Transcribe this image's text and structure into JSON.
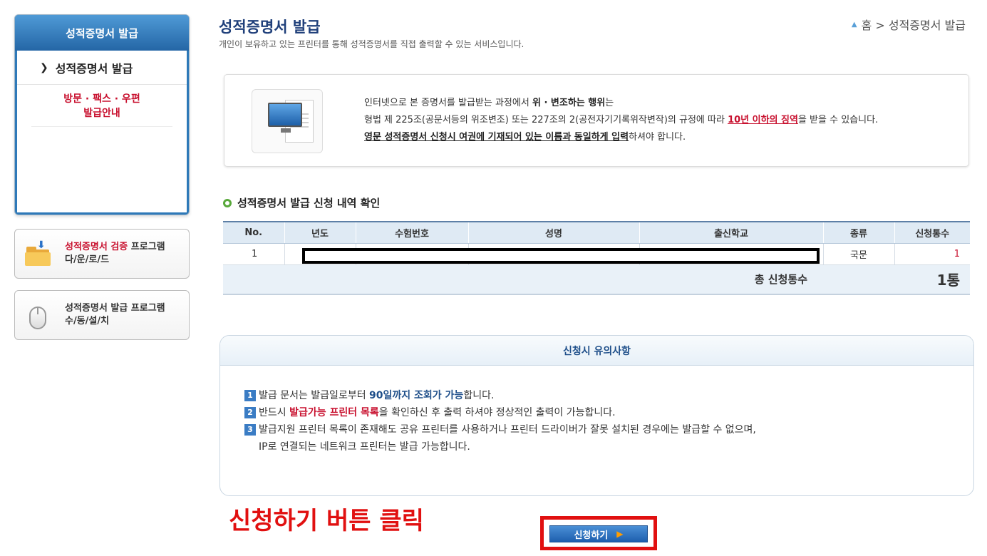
{
  "sidebar": {
    "header": "성적증명서 발급",
    "items": [
      {
        "label": "성적증명서 발급"
      },
      {
        "label_line1": "방문 · 팩스 · 우편",
        "label_line2": "발급안내"
      }
    ],
    "programs": [
      {
        "red_text": "성적증명서 검증",
        "text": " 프로그램",
        "line2": "다/운/로/드",
        "icon": "folder-download-icon"
      },
      {
        "text": "성적증명서 발급 프로그램",
        "line2": "수/동/설/치",
        "icon": "mouse-icon"
      }
    ]
  },
  "header": {
    "title": "성적증명서 발급",
    "subtitle": "개인이 보유하고 있는 프린터를 통해 성적증명서를 직접 출력할 수 있는 서비스입니다.",
    "breadcrumb": "홈 > 성적증명서 발급"
  },
  "notice": {
    "line1_pre": "인터넷으로 본 증명서를 발급받는 과정에서 ",
    "line1_bold": "위 · 변조하는 행위",
    "line1_post": "는",
    "line2_pre": "형법 제 225조(공문서등의 위조변조) 또는 227조의 2(공전자기기록위작변작)의 규정에 따라 ",
    "line2_red": "10년 이하의 징역",
    "line2_post": "을 받을 수 있습니다.",
    "line3_ul": "영문 성적증명서 신청시 여권에 기재되어 있는 이름과 동일하게 입력",
    "line3_post": "하셔야 합니다."
  },
  "table": {
    "section_title": "성적증명서 발급 신청 내역 확인",
    "columns": [
      "No.",
      "년도",
      "수험번호",
      "성명",
      "출신학교",
      "종류",
      "신청통수"
    ],
    "rows": [
      {
        "no": "1",
        "year": "",
        "exam_no": "",
        "name": "",
        "school": "",
        "type": "국문",
        "count": "1"
      }
    ],
    "total_label": "총 신청통수",
    "total_value": "1통"
  },
  "cautions": {
    "title": "신청시 유의사항",
    "items": [
      {
        "num": "1",
        "pre": "발급 문서는 발급일로부터 ",
        "em": "90일까지 조회가 가능",
        "post": "합니다."
      },
      {
        "num": "2",
        "pre": "반드시 ",
        "em": "발급가능 프린터 목록",
        "post": "을 확인하신 후 출력 하셔야 정상적인 출력이 가능합니다."
      },
      {
        "num": "3",
        "pre": "발급지원 프린터 목록이 존재해도 공유 프린터를 사용하거나 프린터 드라이버가 잘못 설치된 경우에는 발급할 수 없으며,",
        "line2": "IP로 연결되는 네트워크 프린터는 발급 가능합니다."
      }
    ]
  },
  "instruction": "신청하기 버튼 클릭",
  "apply_button": "신청하기",
  "colors": {
    "brand_blue": "#2e79b8",
    "accent_red": "#c8102e",
    "annotation_red": "#e11010"
  }
}
